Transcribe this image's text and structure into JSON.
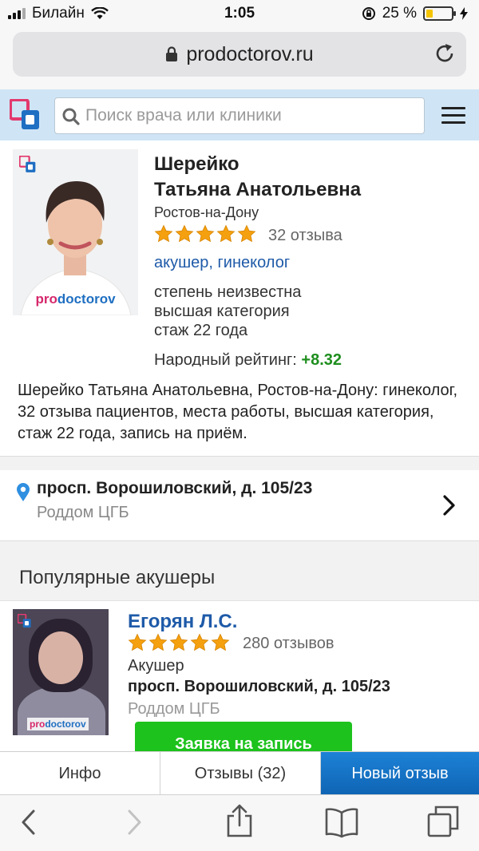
{
  "status_bar": {
    "carrier": "Билайн",
    "time": "1:05",
    "battery_percent": "25 %",
    "battery_level": 0.25
  },
  "browser": {
    "url": "prodoctorov.ru"
  },
  "site_header": {
    "search_placeholder": "Поиск врача или клиники"
  },
  "doctor": {
    "surname": "Шерейко",
    "given_names": "Татьяна Анатольевна",
    "city": "Ростов-на-Дону",
    "rating_stars": 5,
    "reviews": "32 отзыва",
    "specialties": "акушер, гинеколог",
    "degree": "степень неизвестна",
    "category": "высшая категория",
    "experience": "стаж 22 года",
    "people_rating_label": "Народный рейтинг:",
    "people_rating_value": "+8.32",
    "photo_watermark_a": "pro",
    "photo_watermark_b": "doctorov",
    "description": "Шерейко Татьяна Анатольевна, Ростов-на-Дону: гинеколог, 32 отзыва пациентов, места работы, высшая категория, стаж 22 года, запись на приём."
  },
  "workplace": {
    "address": "просп. Ворошиловский, д. 105/23",
    "clinic": "Роддом ЦГБ"
  },
  "popular": {
    "title": "Популярные акушеры",
    "doctors": [
      {
        "name": "Егорян Л.С.",
        "rating_stars": 5,
        "reviews": "280 отзывов",
        "specialty": "Акушер",
        "address": "просп. Ворошиловский, д. 105/23",
        "clinic": "Роддом ЦГБ",
        "book_label": "Заявка на запись",
        "watermark_a": "pro",
        "watermark_b": "doctorov"
      }
    ]
  },
  "tabs": [
    {
      "label": "Инфо"
    },
    {
      "label": "Отзывы (32)"
    },
    {
      "label": "Новый отзыв"
    }
  ],
  "colors": {
    "header_bg": "#cfe5f6",
    "link_blue": "#1e5aa8",
    "star_orange": "#f5a00f",
    "rating_green": "#1e8e1e",
    "book_green": "#1dc21d",
    "tab_active_blue": "#1476c8"
  },
  "icons": [
    "signal-icon",
    "wifi-icon",
    "lock-icon",
    "battery-icon",
    "reload-icon",
    "logo-icon",
    "search-icon",
    "menu-icon",
    "star-icon",
    "pin-icon",
    "chevron-right-icon",
    "back-icon",
    "forward-icon",
    "share-icon",
    "bookmarks-icon",
    "tabs-icon"
  ]
}
